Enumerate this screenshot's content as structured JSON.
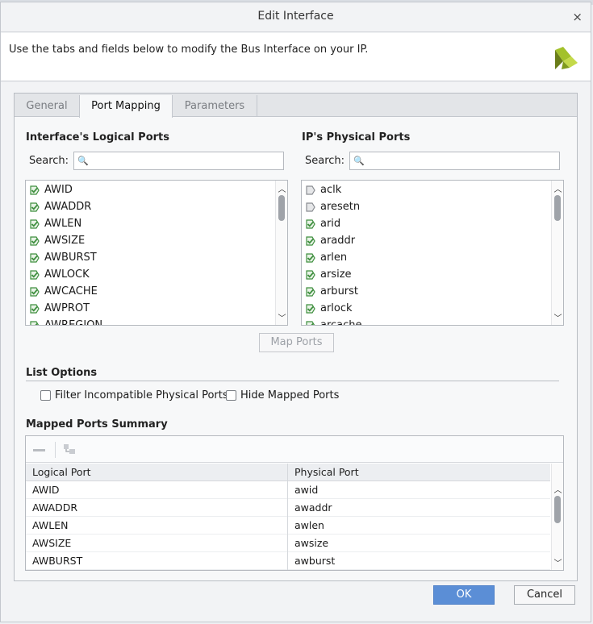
{
  "window": {
    "title": "Edit Interface",
    "close_glyph": "×"
  },
  "header": {
    "description": "Use the tabs and fields below to modify the Bus Interface on your IP.",
    "logo_icon": "vivado-logo-icon"
  },
  "tabs": [
    {
      "label": "General",
      "active": false
    },
    {
      "label": "Port Mapping",
      "active": true
    },
    {
      "label": "Parameters",
      "active": false
    }
  ],
  "logical_ports": {
    "title": "Interface's Logical Ports",
    "search_label": "Search:",
    "search_placeholder": "",
    "items": [
      "AWID",
      "AWADDR",
      "AWLEN",
      "AWSIZE",
      "AWBURST",
      "AWLOCK",
      "AWCACHE",
      "AWPROT",
      "AWREGION"
    ]
  },
  "physical_ports": {
    "title": "IP's Physical Ports",
    "search_label": "Search:",
    "search_placeholder": "",
    "items": [
      {
        "name": "aclk",
        "mapped": false
      },
      {
        "name": "aresetn",
        "mapped": false
      },
      {
        "name": "arid",
        "mapped": true
      },
      {
        "name": "araddr",
        "mapped": true
      },
      {
        "name": "arlen",
        "mapped": true
      },
      {
        "name": "arsize",
        "mapped": true
      },
      {
        "name": "arburst",
        "mapped": true
      },
      {
        "name": "arlock",
        "mapped": true
      },
      {
        "name": "arcache",
        "mapped": true
      }
    ]
  },
  "map_ports_button": "Map Ports",
  "list_options": {
    "title": "List Options",
    "filter_incompatible": {
      "label": "Filter Incompatible Physical Ports",
      "checked": false
    },
    "hide_mapped": {
      "label": "Hide Mapped Ports",
      "checked": false
    }
  },
  "summary": {
    "title": "Mapped Ports Summary",
    "columns": [
      "Logical Port",
      "Physical Port"
    ],
    "rows": [
      [
        "AWID",
        "awid"
      ],
      [
        "AWADDR",
        "awaddr"
      ],
      [
        "AWLEN",
        "awlen"
      ],
      [
        "AWSIZE",
        "awsize"
      ],
      [
        "AWBURST",
        "awburst"
      ]
    ]
  },
  "footer": {
    "ok_label": "OK",
    "cancel_label": "Cancel"
  },
  "colors": {
    "accent": "#5b8ed6",
    "port_icon_green": "#3f8f3f",
    "logo_green": "#8fb21f"
  }
}
